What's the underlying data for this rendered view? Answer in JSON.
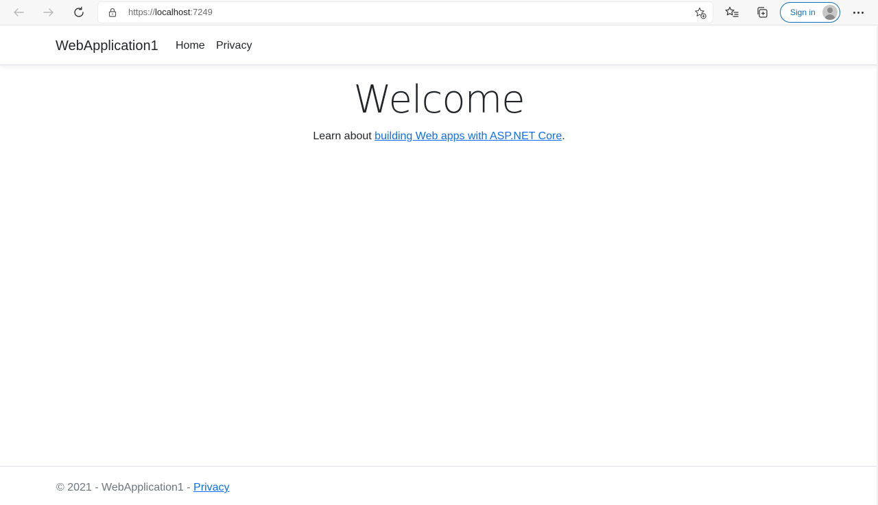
{
  "browser": {
    "url_scheme": "https://",
    "url_host": "localhost",
    "url_rest": ":7249",
    "sign_in_label": "Sign in",
    "icons": {
      "back": "arrow-left-icon",
      "forward": "arrow-right-icon",
      "refresh": "refresh-icon",
      "lock": "lock-icon",
      "add_favorite": "star-plus-icon",
      "favorites": "favorites-icon",
      "collections": "collections-icon",
      "more": "ellipsis-icon"
    },
    "accent_color": "#0f6cbd"
  },
  "navbar": {
    "brand": "WebApplication1",
    "links": [
      {
        "label": "Home"
      },
      {
        "label": "Privacy"
      }
    ]
  },
  "main": {
    "heading": "Welcome",
    "learn_prefix": "Learn about ",
    "learn_link": "building Web apps with ASP.NET Core",
    "learn_suffix": "."
  },
  "footer": {
    "copyright": "© 2021 - WebApplication1 - ",
    "privacy_link": "Privacy",
    "link_color": "#0d6efd"
  }
}
